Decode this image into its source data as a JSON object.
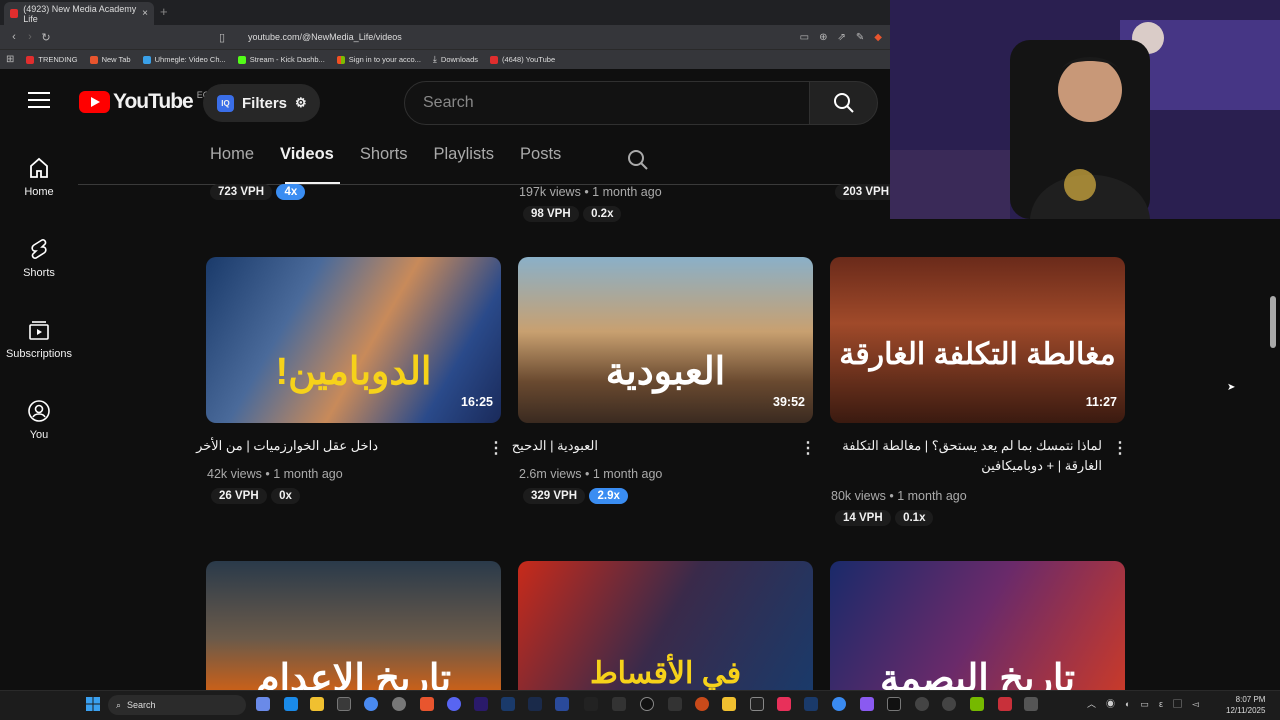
{
  "browser": {
    "tab_title": "(4923) New Media Academy Life",
    "tab_close": "×",
    "new_tab": "+",
    "url": "youtube.com/@NewMedia_Life/videos",
    "bookmarks": [
      "TRENDING",
      "New Tab",
      "Uhmegle: Video Ch...",
      "Stream - Kick Dashb...",
      "Sign in to your acco...",
      "Downloads",
      "(4648) YouTube"
    ]
  },
  "header": {
    "logo_text": "YouTube",
    "region": "EG",
    "filters_label": "Filters",
    "filters_badge": "IQ",
    "search_placeholder": "Search"
  },
  "sidebar": [
    {
      "label": "Home",
      "icon": "home-icon"
    },
    {
      "label": "Shorts",
      "icon": "shorts-icon"
    },
    {
      "label": "Subscriptions",
      "icon": "subscriptions-icon"
    },
    {
      "label": "You",
      "icon": "you-icon"
    }
  ],
  "channel_tabs": [
    {
      "label": "Home",
      "active": false
    },
    {
      "label": "Videos",
      "active": true
    },
    {
      "label": "Shorts",
      "active": false
    },
    {
      "label": "Playlists",
      "active": false
    },
    {
      "label": "Posts",
      "active": false
    }
  ],
  "prev_row": [
    {
      "vph": "723 VPH",
      "mult": "4x"
    },
    {
      "views": "197k views",
      "age": "1 month ago",
      "vph": "98 VPH",
      "mult": "0.2x"
    },
    {
      "vph": "203 VPH"
    }
  ],
  "videos": [
    {
      "title": "داخل عقل الخوارزميات | من الأخر",
      "duration": "16:25",
      "views": "42k views",
      "age": "1 month ago",
      "vph": "26 VPH",
      "mult": "0x",
      "thumb_text": "الدوبامين!"
    },
    {
      "title": "العبودية | الدحيح",
      "duration": "39:52",
      "views": "2.6m views",
      "age": "1 month ago",
      "vph": "329 VPH",
      "mult": "2.9x",
      "thumb_text": "العبودية"
    },
    {
      "title": "لماذا نتمسك بما لم يعد يستحق؟ | مغالطة التكلفة الغارقة | + دوباميكافين",
      "duration": "11:27",
      "views": "80k views",
      "age": "1 month ago",
      "vph": "14 VPH",
      "mult": "0.1x",
      "thumb_text": "مغالطة التكلفة الغارقة"
    }
  ],
  "next_row_thumbs": [
    "تاريخ الإعدام",
    "في الأقساط",
    "تاريخ البصمة"
  ],
  "taskbar": {
    "search": "Search",
    "time": "8:07 PM",
    "date": "12/11/2025"
  },
  "colors": {
    "yt_red": "#ff0000",
    "accent_blue": "#3a8df2",
    "bg": "#0f0f0f"
  }
}
